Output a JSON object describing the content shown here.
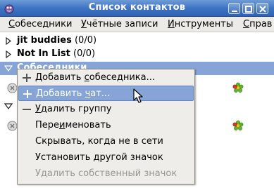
{
  "window": {
    "title": "Список контактов"
  },
  "menubar": {
    "items": [
      {
        "pre": "",
        "u": "С",
        "post": "обеседники"
      },
      {
        "pre": "",
        "u": "У",
        "post": "чётные записи"
      },
      {
        "pre": "",
        "u": "И",
        "post": "нструменты"
      },
      {
        "pre": "",
        "u": "С",
        "post": "прав"
      }
    ]
  },
  "tree": {
    "groups": [
      {
        "name": "jit buddies",
        "count": "(0/0)"
      },
      {
        "name": "Not In List",
        "count": "(0/0)"
      },
      {
        "name": "Собеседники"
      }
    ]
  },
  "context_menu": {
    "items": [
      {
        "pre": "Добавить ",
        "u": "с",
        "post": "обеседника...",
        "icon": "plus-icon"
      },
      {
        "pre": "Добавить ",
        "u": "ч",
        "post": "ат...",
        "icon": "plus-icon",
        "highlighted": true
      },
      {
        "pre": "",
        "u": "У",
        "post": "далить группу",
        "icon": "minus-icon"
      },
      {
        "pre": "Пере",
        "u": "и",
        "post": "меновать"
      },
      {
        "pre": "Скрывать, когда не в сети"
      },
      {
        "pre": "Установить другой значок"
      },
      {
        "pre": "Удалить собственный значок",
        "disabled": true
      }
    ]
  },
  "colors": {
    "titlebar": "#3f74c4",
    "selection": "#86a5d6",
    "icq_flower": "#5cb82e"
  }
}
